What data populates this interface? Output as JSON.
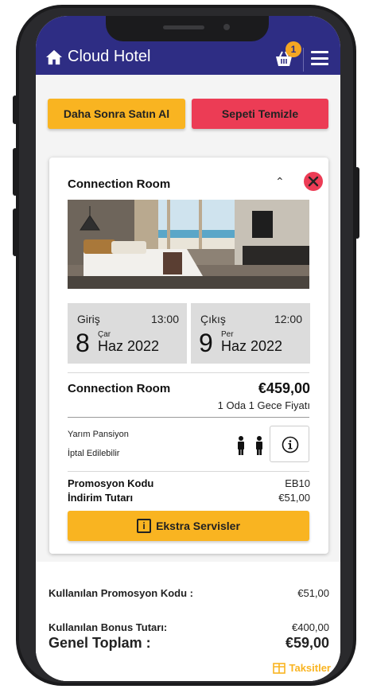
{
  "app": {
    "title": "Cloud Hotel"
  },
  "header": {
    "cart_count": "1"
  },
  "actions": {
    "buy_later": "Daha Sonra Satın Al",
    "clear_cart": "Sepeti Temizle"
  },
  "room": {
    "name": "Connection Room",
    "checkin": {
      "label": "Giriş",
      "time": "13:00",
      "day": "8",
      "weekday": "Çar",
      "month_year": "Haz 2022"
    },
    "checkout": {
      "label": "Çıkış",
      "time": "12:00",
      "day": "9",
      "weekday": "Per",
      "month_year": "Haz 2022"
    },
    "price_name": "Connection Room",
    "price": "€459,00",
    "price_note": "1 Oda 1 Gece Fiyatı",
    "board": "Yarım Pansiyon",
    "cancel": "İptal Edilebilir",
    "promo_label": "Promosyon Kodu",
    "promo_code": "EB10",
    "discount_label": "İndirim Tutarı",
    "discount": "€51,00",
    "extra_services": "Ekstra Servisler"
  },
  "summary": {
    "promo_used_label": "Kullanılan Promosyon Kodu :",
    "promo_used_value": "€51,00",
    "bonus_label": "Kullanılan Bonus Tutarı:",
    "bonus_value": "€400,00",
    "total_label": "Genel Toplam :",
    "total_value": "€59,00",
    "installments": "Taksitler"
  },
  "colors": {
    "header": "#2e2d84",
    "accent": "#f9b421",
    "danger": "#ec3c55"
  },
  "icons": [
    "home-icon",
    "cart-icon",
    "menu-icon",
    "chevron-up-icon",
    "close-icon",
    "person-icon",
    "info-icon",
    "table-icon"
  ]
}
